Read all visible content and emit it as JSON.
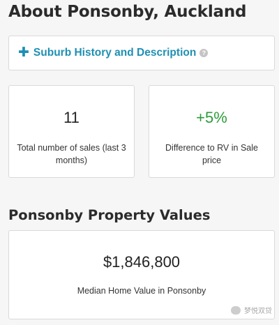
{
  "header": {
    "title": "About Ponsonby, Auckland"
  },
  "history": {
    "label": "Suburb History and Description"
  },
  "stats": [
    {
      "value": "11",
      "label": "Total number of sales (last 3 months)"
    },
    {
      "value": "+5%",
      "label": "Difference to RV in Sale price"
    }
  ],
  "values_section": {
    "title": "Ponsonby Property Values",
    "median_value": "$1,846,800",
    "median_label": "Median Home Value in Ponsonby"
  },
  "watermark": {
    "text": "梦悦双贷"
  },
  "colors": {
    "link": "#1e8fb3",
    "positive": "#2d9b3b"
  }
}
